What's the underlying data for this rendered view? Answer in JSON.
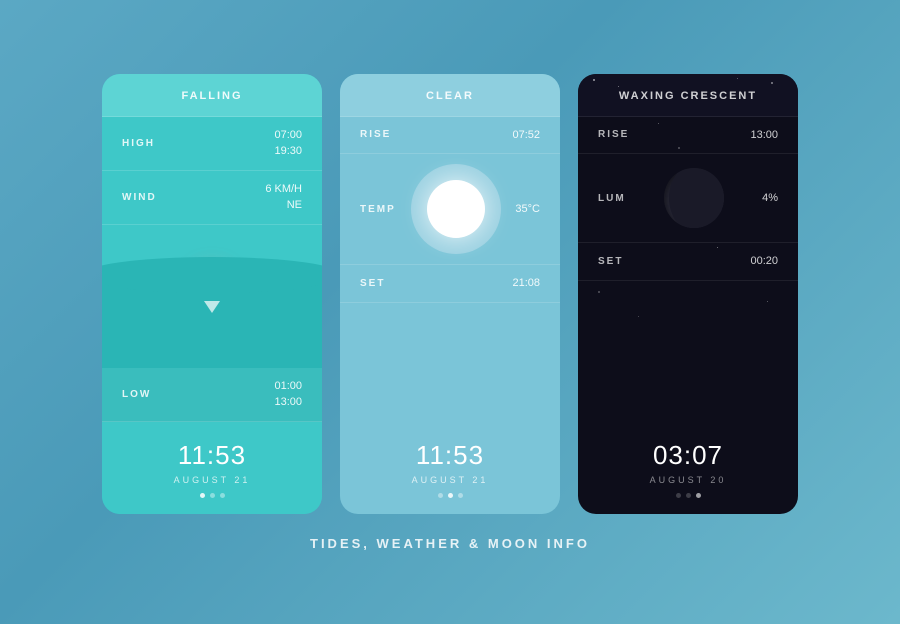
{
  "page": {
    "title": "TIDES, WEATHER & MOON INFO",
    "background": "#5ba8c4"
  },
  "tides_card": {
    "header": "FALLING",
    "high_label": "HIGH",
    "high_time1": "07:00",
    "high_time2": "19:30",
    "wind_label": "WIND",
    "wind_speed": "6 KM/H",
    "wind_dir": "NE",
    "low_label": "LOW",
    "low_time1": "01:00",
    "low_time2": "13:00",
    "time": "11:53",
    "date": "AUGUST 21"
  },
  "weather_card": {
    "header": "CLEAR",
    "rise_label": "RISE",
    "rise_time": "07:52",
    "temp_label": "TEMP",
    "temp_value": "35°C",
    "set_label": "SET",
    "set_time": "21:08",
    "time": "11:53",
    "date": "AUGUST 21"
  },
  "moon_card": {
    "header": "WAXING CRESCENT",
    "rise_label": "RISE",
    "rise_time": "13:00",
    "lum_label": "LUM",
    "lum_value": "4%",
    "set_label": "SET",
    "set_time": "00:20",
    "time": "03:07",
    "date": "AUGUST 20"
  }
}
